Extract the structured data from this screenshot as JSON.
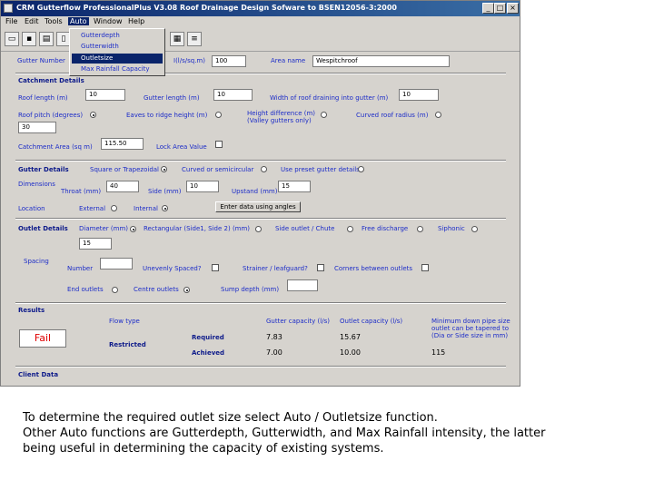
{
  "window": {
    "title": "CRM Gutterflow ProfessionalPlus V3.08 Roof Drainage Design Sofware to BSEN12056-3:2000",
    "min": "_",
    "max": "□",
    "close": "×"
  },
  "menu": [
    "File",
    "Edit",
    "Tools",
    "Auto",
    "Window",
    "Help"
  ],
  "auto_menu": [
    "Gutterdepth",
    "Gutterwidth",
    "Outletsize",
    "Max Rainfall Capacity"
  ],
  "header_row": {
    "gutter_number_label": "Gutter Number",
    "rainfall_label": "I(l/s/sq.m)",
    "rainfall_value": "100",
    "area_name_label": "Area name",
    "area_name_value": "Wespitchroof"
  },
  "catchment": {
    "title": "Catchment Details",
    "roof_length_label": "Roof length (m)",
    "roof_length_value": "10",
    "gutter_length_label": "Gutter length (m)",
    "gutter_length_value": "10",
    "width_label": "Width of roof draining into gutter (m)",
    "width_value": "10",
    "roof_pitch_label": "Roof pitch (degrees)",
    "roof_pitch_value": "30",
    "eaves_label": "Eaves to ridge height (m)",
    "height_diff_label": "Height difference (m)",
    "height_diff_sub": "(Valley gutters only)",
    "curved_label": "Curved roof radius (m)",
    "catchment_area_label": "Catchment Area (sq m)",
    "catchment_area_value": "115.50",
    "lock_area_label": "Lock Area Value"
  },
  "gutter": {
    "title": "Gutter Details",
    "square_label": "Square or Trapezoidal",
    "curved_label": "Curved or semicircular",
    "preset_label": "Use preset gutter details",
    "dimensions_label": "Dimensions",
    "throat_label": "Throat (mm)",
    "throat_value": "40",
    "side_label": "Side (mm)",
    "side_value": "10",
    "upstand_label": "Upstand (mm)",
    "upstand_value": "15",
    "location_label": "Location",
    "external_label": "External",
    "internal_label": "Internal",
    "angles_button": "Enter data using angles"
  },
  "outlet": {
    "title": "Outlet Details",
    "diameter_label": "Diameter (mm)",
    "rect_label": "Rectangular (Side1, Side 2) (mm)",
    "side_outlet_label": "Side outlet / Chute",
    "free_label": "Free discharge",
    "siphonic_label": "Siphonic",
    "diameter_value": "15",
    "spacing_label": "Spacing",
    "number_label": "Number",
    "unevenly_label": "Unevenly Spaced?",
    "strainer_label": "Strainer / leafguard?",
    "corners_label": "Corners between outlets",
    "end_label": "End outlets",
    "centre_label": "Centre outlets",
    "sump_label": "Sump depth (mm)"
  },
  "results": {
    "title": "Results",
    "status": "Fail",
    "flow_type_label": "Flow type",
    "flow_type_value": "Restricted",
    "gutter_capacity_label": "Gutter capacity (l/s)",
    "outlet_capacity_label": "Outlet capacity (l/s)",
    "min_size_label_1": "Minimum down pipe size",
    "min_size_label_2": "outlet can be tapered to",
    "min_size_label_3": "(Dia or Side size in mm)",
    "required_label": "Required",
    "achieved_label": "Achieved",
    "required_gutter": "7.83",
    "required_outlet": "15.67",
    "achieved_gutter": "7.00",
    "achieved_outlet": "10.00",
    "achieved_min": "115"
  },
  "client_label": "Client Data",
  "caption": [
    "To determine the required outlet size select  Auto / Outletsize function.",
    "Other Auto functions are Gutterdepth, Gutterwidth, and Max Rainfall intensity, the latter",
    "being useful in determining the capacity of existing systems."
  ]
}
